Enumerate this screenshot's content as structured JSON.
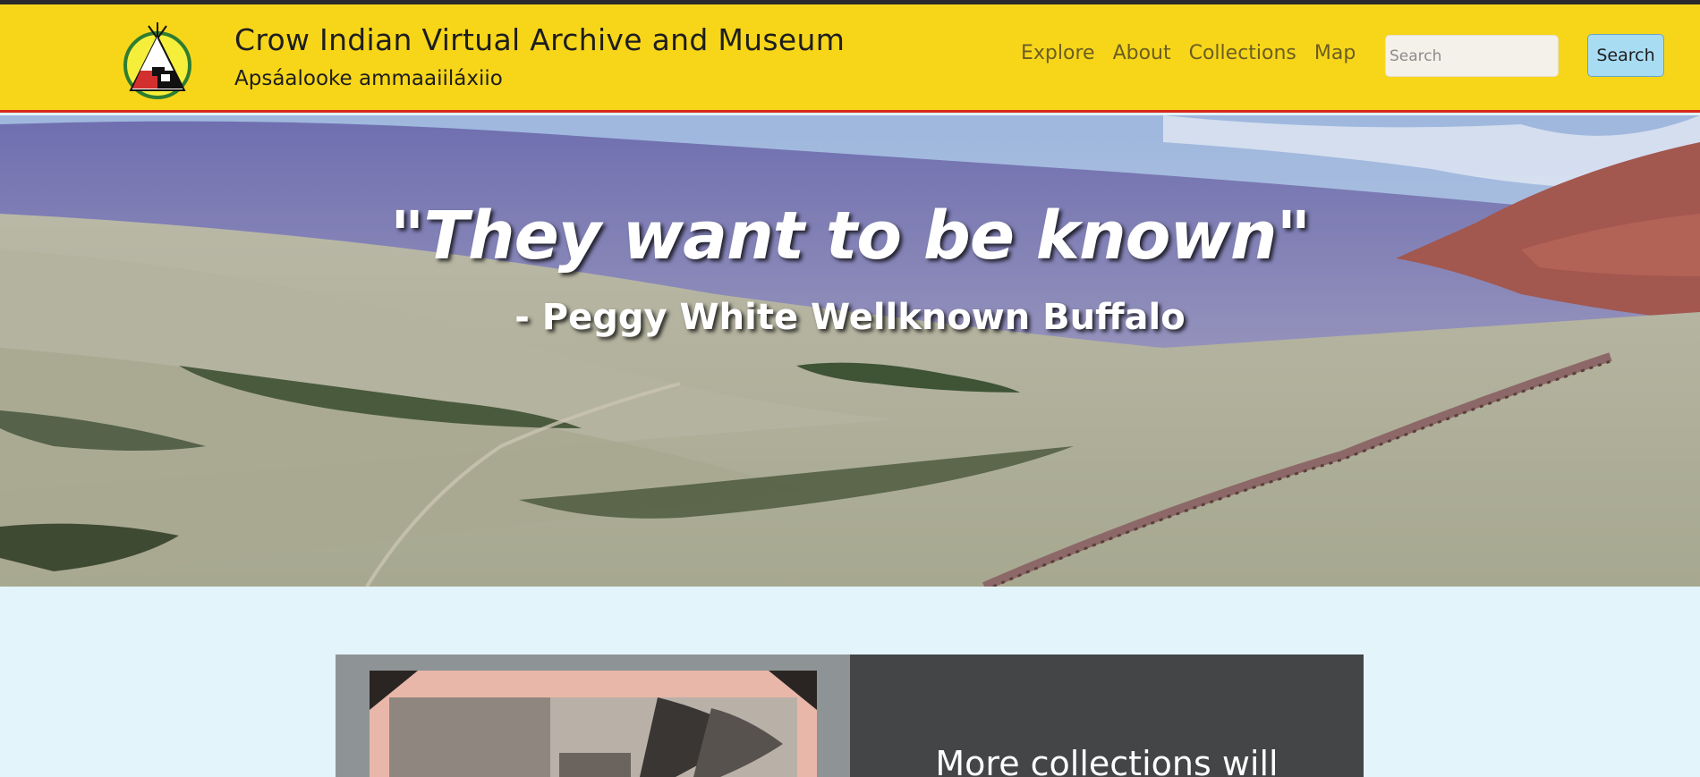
{
  "header": {
    "title": "Crow Indian Virtual Archive and Museum",
    "subtitle": "Apsáalooke ammaaiiláxiio",
    "logo_icon": "tipi-medicine-wheel-logo",
    "nav": [
      {
        "label": "Explore"
      },
      {
        "label": "About"
      },
      {
        "label": "Collections"
      },
      {
        "label": "Map"
      }
    ],
    "search": {
      "placeholder": "Search",
      "value": "",
      "button_label": "Search"
    },
    "colors": {
      "background": "#f7d619",
      "accent_border": "#d7261c",
      "search_button": "#a8dcf3"
    }
  },
  "hero": {
    "quote": "\"They want to be known\"",
    "attribution": "- Peggy White Wellknown Buffalo",
    "image": "prairie-valley-cattle-drive-photo"
  },
  "feature": {
    "image": "archival-photo-in-album",
    "text": "More collections will"
  }
}
